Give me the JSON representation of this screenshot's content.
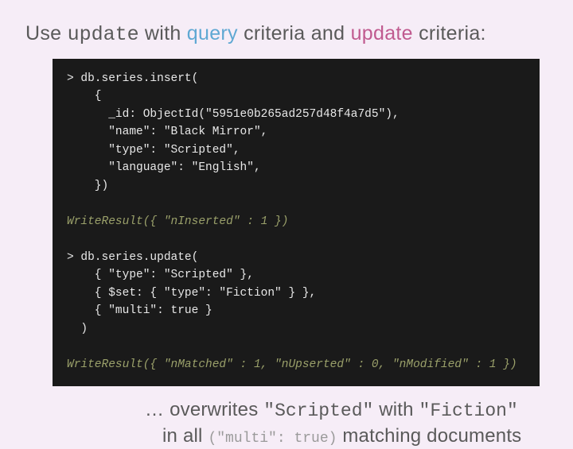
{
  "heading": {
    "pre": "Use ",
    "update1": "update",
    "mid1": " with ",
    "query": "query",
    "mid2": " criteria and ",
    "update2": "update",
    "post": " criteria:"
  },
  "code": {
    "line1": "> db.series.insert(",
    "line2": "    {",
    "line3": "      _id: ObjectId(\"5951e0b265ad257d48f4a7d5\"),",
    "line4": "      \"name\": \"Black Mirror\",",
    "line5": "      \"type\": \"Scripted\",",
    "line6": "      \"language\": \"English\",",
    "line7": "    })",
    "blank1": "",
    "result1": "WriteResult({ \"nInserted\" : 1 })",
    "blank2": "",
    "line8": "> db.series.update(",
    "line9": "    { \"type\": \"Scripted\" },",
    "line10": "    { $set: { \"type\": \"Fiction\" } },",
    "line11": "    { \"multi\": true }",
    "line12": "  )",
    "blank3": "",
    "result2": "WriteResult({ \"nMatched\" : 1, \"nUpserted\" : 0, \"nModified\" : 1 })"
  },
  "caption": {
    "l1_pre": "… overwrites ",
    "scripted": "\"Scripted\"",
    "l1_mid": " with ",
    "fiction": "\"Fiction\"",
    "l2_pre": "in all ",
    "multi": "(\"multi\": true)",
    "l2_post": " matching documents"
  }
}
